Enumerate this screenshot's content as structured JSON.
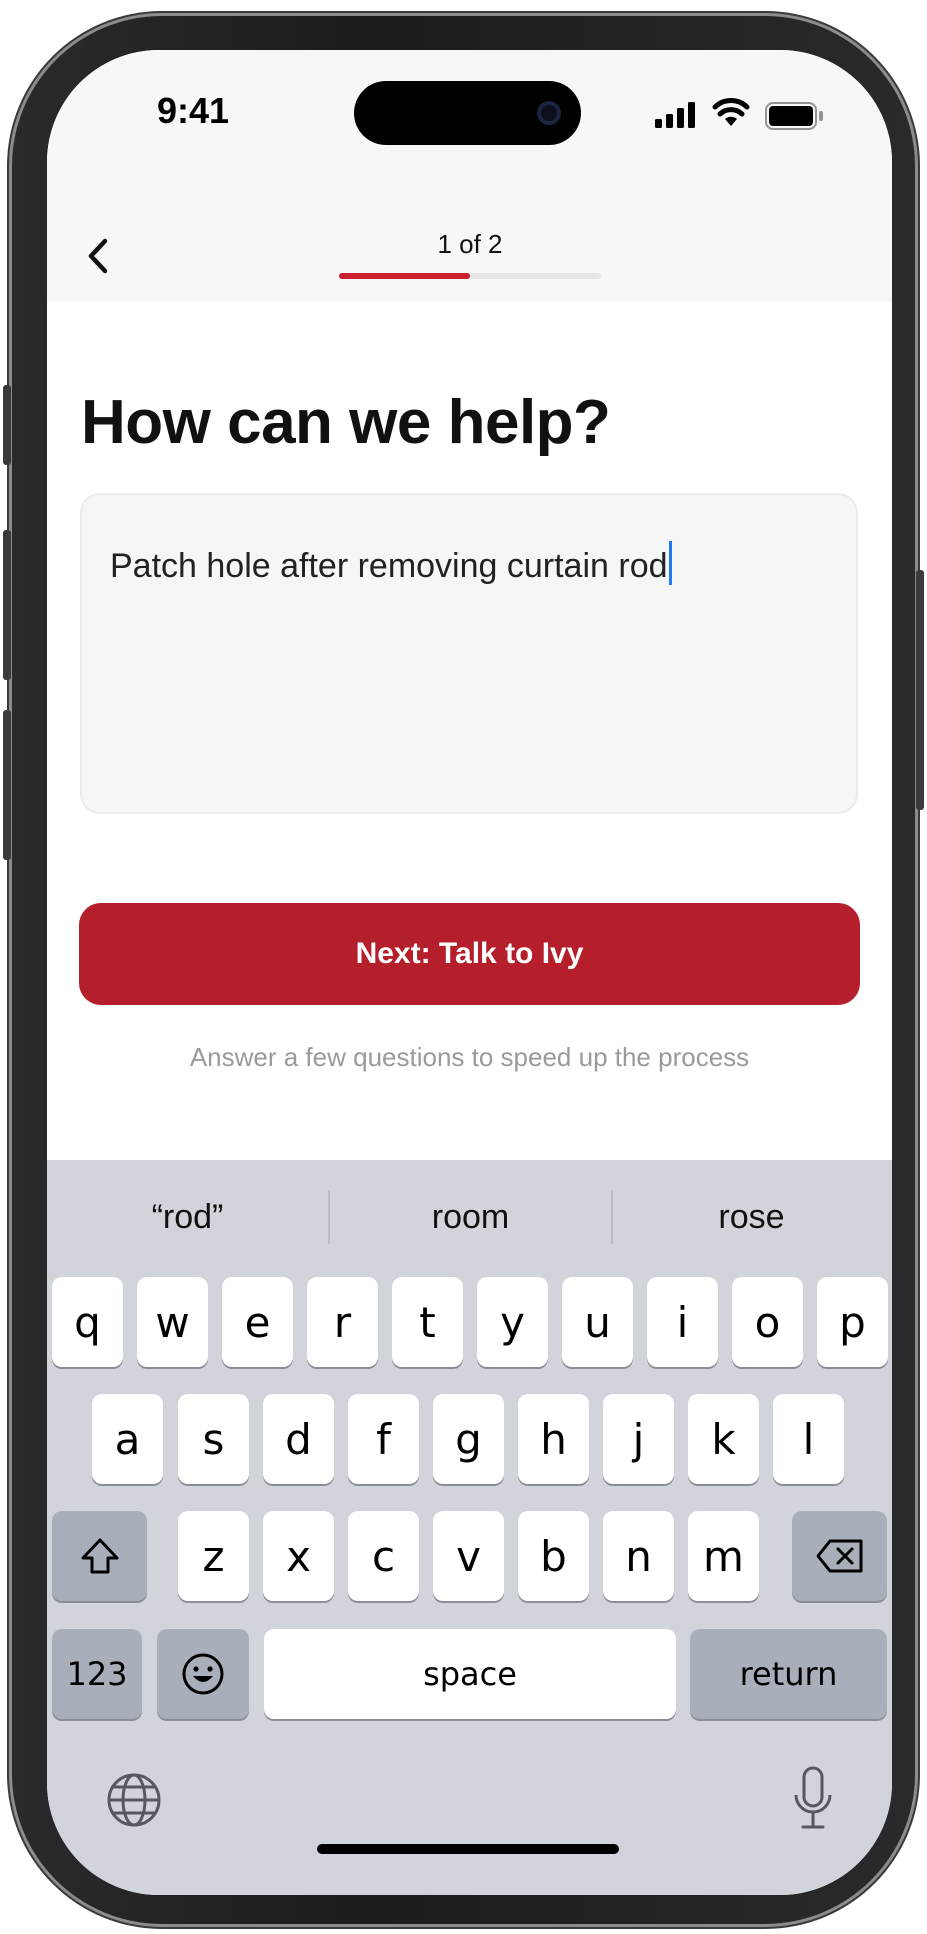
{
  "status": {
    "time": "9:41"
  },
  "header": {
    "step_label": "1 of 2",
    "progress": 0.5
  },
  "main": {
    "title": "How can we help?",
    "description_value": "Patch hole after removing curtain rod",
    "next_button_label": "Next: Talk to Ivy",
    "hint": "Answer a few questions to speed up the process"
  },
  "keyboard": {
    "suggestions": [
      "“rod”",
      "room",
      "rose"
    ],
    "row1": [
      "q",
      "w",
      "e",
      "r",
      "t",
      "y",
      "u",
      "i",
      "o",
      "p"
    ],
    "row2": [
      "a",
      "s",
      "d",
      "f",
      "g",
      "h",
      "j",
      "k",
      "l"
    ],
    "row3": [
      "z",
      "x",
      "c",
      "v",
      "b",
      "n",
      "m"
    ],
    "numbers_label": "123",
    "space_label": "space",
    "return_label": "return"
  },
  "colors": {
    "accent": "#b51f2b",
    "progress": "#c8202c",
    "caret": "#1e7bf0",
    "keyboard_bg": "#d1d4db"
  },
  "icons": [
    "back-chevron-icon",
    "signal-icon",
    "wifi-icon",
    "battery-icon",
    "shift-icon",
    "delete-icon",
    "emoji-icon",
    "globe-icon",
    "microphone-icon"
  ]
}
